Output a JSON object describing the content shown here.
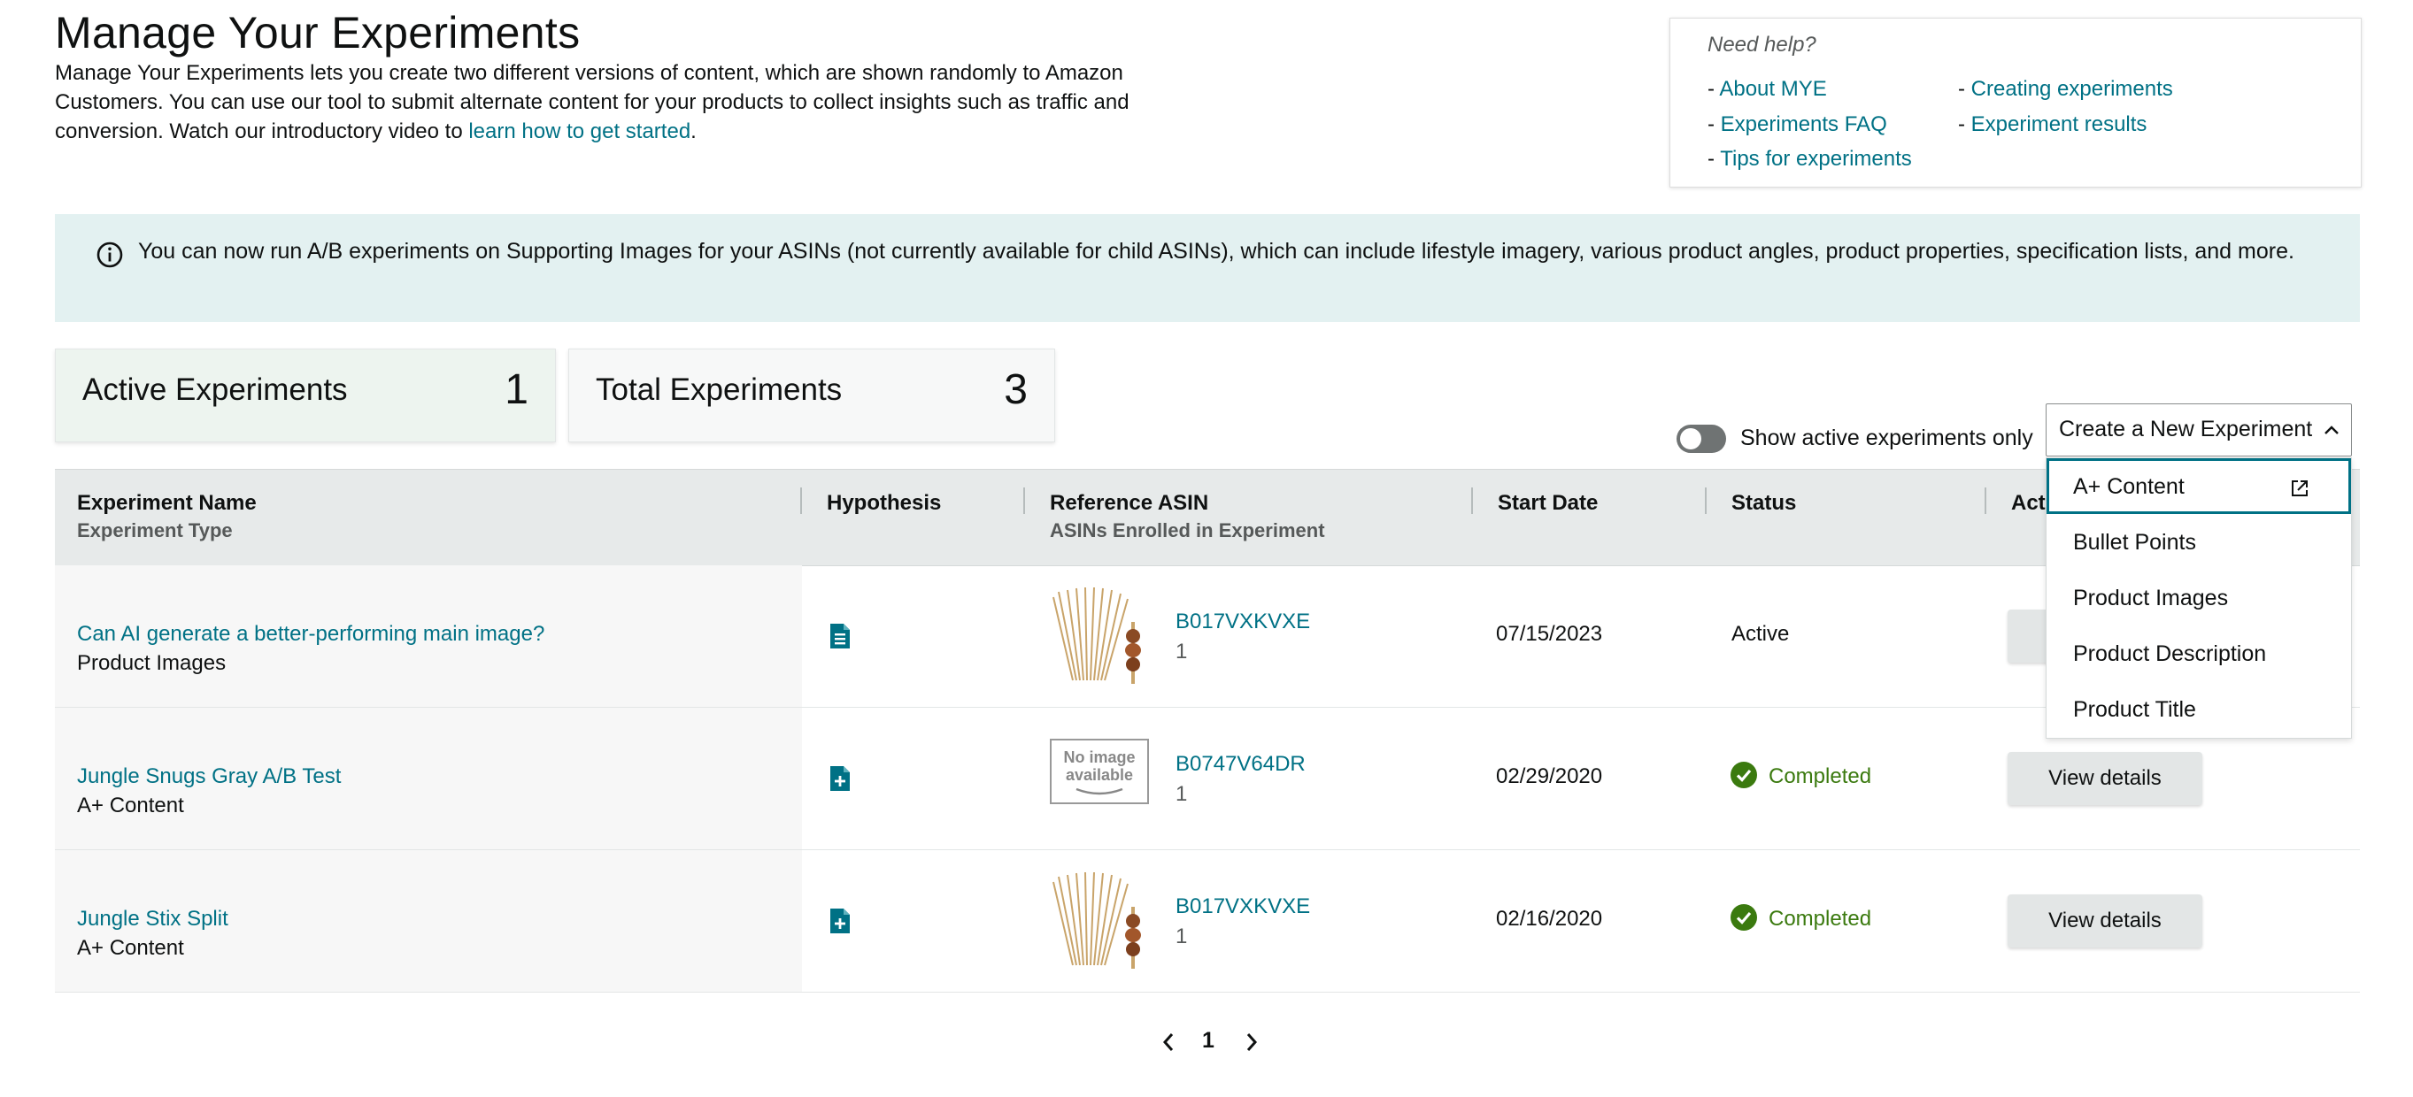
{
  "header": {
    "title": "Manage Your Experiments",
    "intro_text": "Manage Your Experiments lets you create two different versions of content, which are shown randomly to Amazon Customers. You can use our tool to submit alternate content for your products to collect insights such as traffic and conversion. Watch our introductory video to ",
    "intro_link": "learn how to get started",
    "intro_end": "."
  },
  "help": {
    "title": "Need help?",
    "links": [
      "About MYE",
      "Experiments FAQ",
      "Tips for experiments",
      "Creating experiments",
      "Experiment results"
    ]
  },
  "banner": {
    "icon": "info-icon",
    "text": "You can now run A/B experiments on Supporting Images for your ASINs (not currently available for child ASINs), which can include lifestyle imagery, various product angles, product properties, specification lists, and more."
  },
  "stats": {
    "active_label": "Active Experiments",
    "active_value": "1",
    "total_label": "Total Experiments",
    "total_value": "3"
  },
  "filters": {
    "toggle_label": "Show active experiments only",
    "toggle_on": false
  },
  "create_dropdown": {
    "label": "Create a New Experiment",
    "options": [
      "A+ Content",
      "Bullet Points",
      "Product Images",
      "Product Description",
      "Product Title"
    ],
    "focused_option": "A+ Content"
  },
  "table": {
    "columns": {
      "name": "Experiment Name",
      "name_sub": "Experiment Type",
      "hypothesis": "Hypothesis",
      "asin": "Reference ASIN",
      "asin_sub": "ASINs Enrolled in Experiment",
      "start": "Start Date",
      "status": "Status",
      "actions": "Act"
    },
    "rows": [
      {
        "name": "Can AI generate a better-performing main image?",
        "type": "Product Images",
        "hypothesis_icon": "document-icon",
        "asin": "B017VXKVXE",
        "asin_count": "1",
        "start": "07/15/2023",
        "status": "Active",
        "action": ""
      },
      {
        "name": "Jungle Snugs Gray A/B Test",
        "type": "A+ Content",
        "hypothesis_icon": "document-plus-icon",
        "asin": "B0747V64DR",
        "asin_count": "1",
        "start": "02/29/2020",
        "status": "Completed",
        "action": "View details"
      },
      {
        "name": "Jungle Stix Split",
        "type": "A+ Content",
        "hypothesis_icon": "document-plus-icon",
        "asin": "B017VXKVXE",
        "asin_count": "1",
        "start": "02/16/2020",
        "status": "Completed",
        "action": "View details"
      }
    ]
  },
  "thumb_text": {
    "no_image_line1": "No image",
    "no_image_line2": "available"
  },
  "pagination": {
    "current": "1"
  },
  "colors": {
    "link": "#007185",
    "banner_bg": "#e3f1f1",
    "completed": "#3b7a0f",
    "focus": "#007185"
  }
}
